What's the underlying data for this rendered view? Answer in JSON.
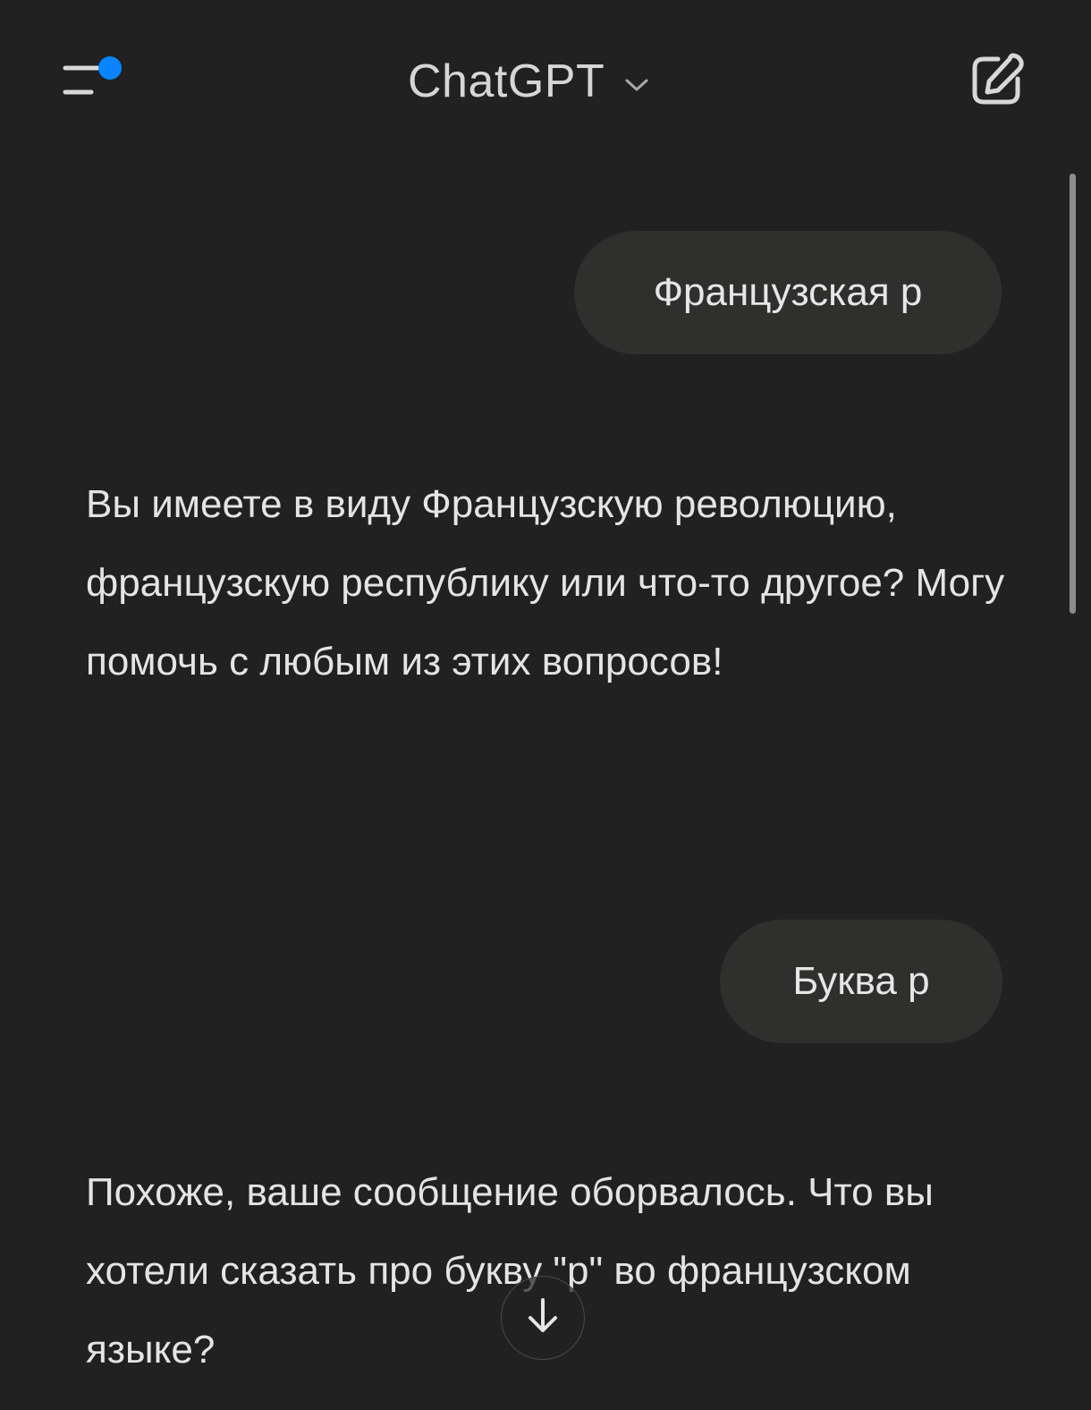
{
  "header": {
    "title": "ChatGPT",
    "menu_icon": "sidebar-menu-icon",
    "notification_dot_color": "#0a84ff",
    "dropdown_icon": "chevron-down-icon",
    "compose_icon": "new-chat-edit-icon"
  },
  "conversation": {
    "messages": [
      {
        "role": "user",
        "text": "Французская р"
      },
      {
        "role": "assistant",
        "text": "Вы имеете в виду Французскую революцию, французскую республику или что-то другое? Могу помочь с любым из этих вопросов!"
      },
      {
        "role": "user",
        "text": "Буква р"
      },
      {
        "role": "assistant",
        "text": "Похоже, ваше сообщение оборвалось. Что вы хотели сказать про букву \"р\" во французском языке?"
      }
    ]
  },
  "scroll_down_icon": "arrow-down-icon",
  "colors": {
    "background": "#212121",
    "user_bubble": "#2f302e",
    "text": "#e4e4e4",
    "accent_dot": "#0a84ff"
  }
}
